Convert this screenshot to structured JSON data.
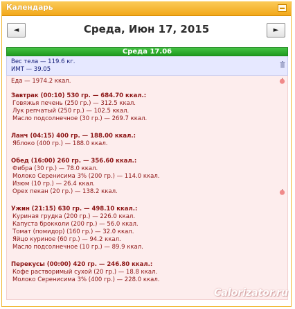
{
  "window": {
    "title": "Календарь"
  },
  "nav": {
    "prev_label": "◄",
    "next_label": "►",
    "date_heading": "Среда, Июн 17, 2015"
  },
  "day": {
    "label": "Среда 17.06"
  },
  "weight": {
    "line1": "Вес тела — 119.6 кг.",
    "line2": "ИМТ — 39.05"
  },
  "food": {
    "total": "Еда — 1974.2 ккал.",
    "meals": [
      {
        "header": "Завтрак (00:10) 530 гр. — 684.70 ккал.:",
        "items": [
          "Говяжья печень (250 гр.) — 312.5 ккал.",
          "Лук репчатый (250 гр.) — 102.5 ккал.",
          "Масло подсолнечное (30 гр.) — 269.7 ккал."
        ]
      },
      {
        "header": "Ланч (04:15) 400 гр. — 188.00 ккал.:",
        "items": [
          "Яблоко (400 гр.) — 188.0 ккал."
        ]
      },
      {
        "header": "Обед (16:00) 260 гр. — 356.60 ккал.:",
        "items": [
          "Фибра (30 гр.) — 78.0 ккал.",
          "Молоко Серенисима 3% (200 гр.) — 114.0 ккал.",
          "Изюм (10 гр.) — 26.4 ккал.",
          "Орех пекан (20 гр.) — 138.2 ккал."
        ]
      },
      {
        "header": "Ужин (21:15) 630 гр. — 498.10 ккал.:",
        "items": [
          "Куриная грудка (200 гр.) — 226.0 ккал.",
          "Капуста брокколи (200 гр.) — 56.0 ккал.",
          "Томат (помидор) (160 гр.) — 32.0 ккал.",
          "Яйцо куриное (60 гр.) — 94.2 ккал.",
          "Масло подсолнечное (10 гр.) — 89.9 ккал."
        ]
      },
      {
        "header": "Перекусы (00:00) 420 гр. — 246.80 ккал.:",
        "items": [
          "Кофе растворимый сухой (20 гр.) — 18.8 ккал.",
          "Молоко Серенисима 3% (400 гр.) — 228.0 ккал."
        ]
      }
    ]
  },
  "watermark": "Calorizator.ru",
  "icons": {
    "minimize": "minimize-icon",
    "trash": "trash-icon",
    "apple": "apple-icon"
  },
  "colors": {
    "title_orange": "#f2a81a",
    "day_green": "#2aa82a",
    "weight_bg": "#e6e8ff",
    "food_bg": "#fdeded",
    "food_text": "#8c1414",
    "weight_text": "#17207a"
  }
}
